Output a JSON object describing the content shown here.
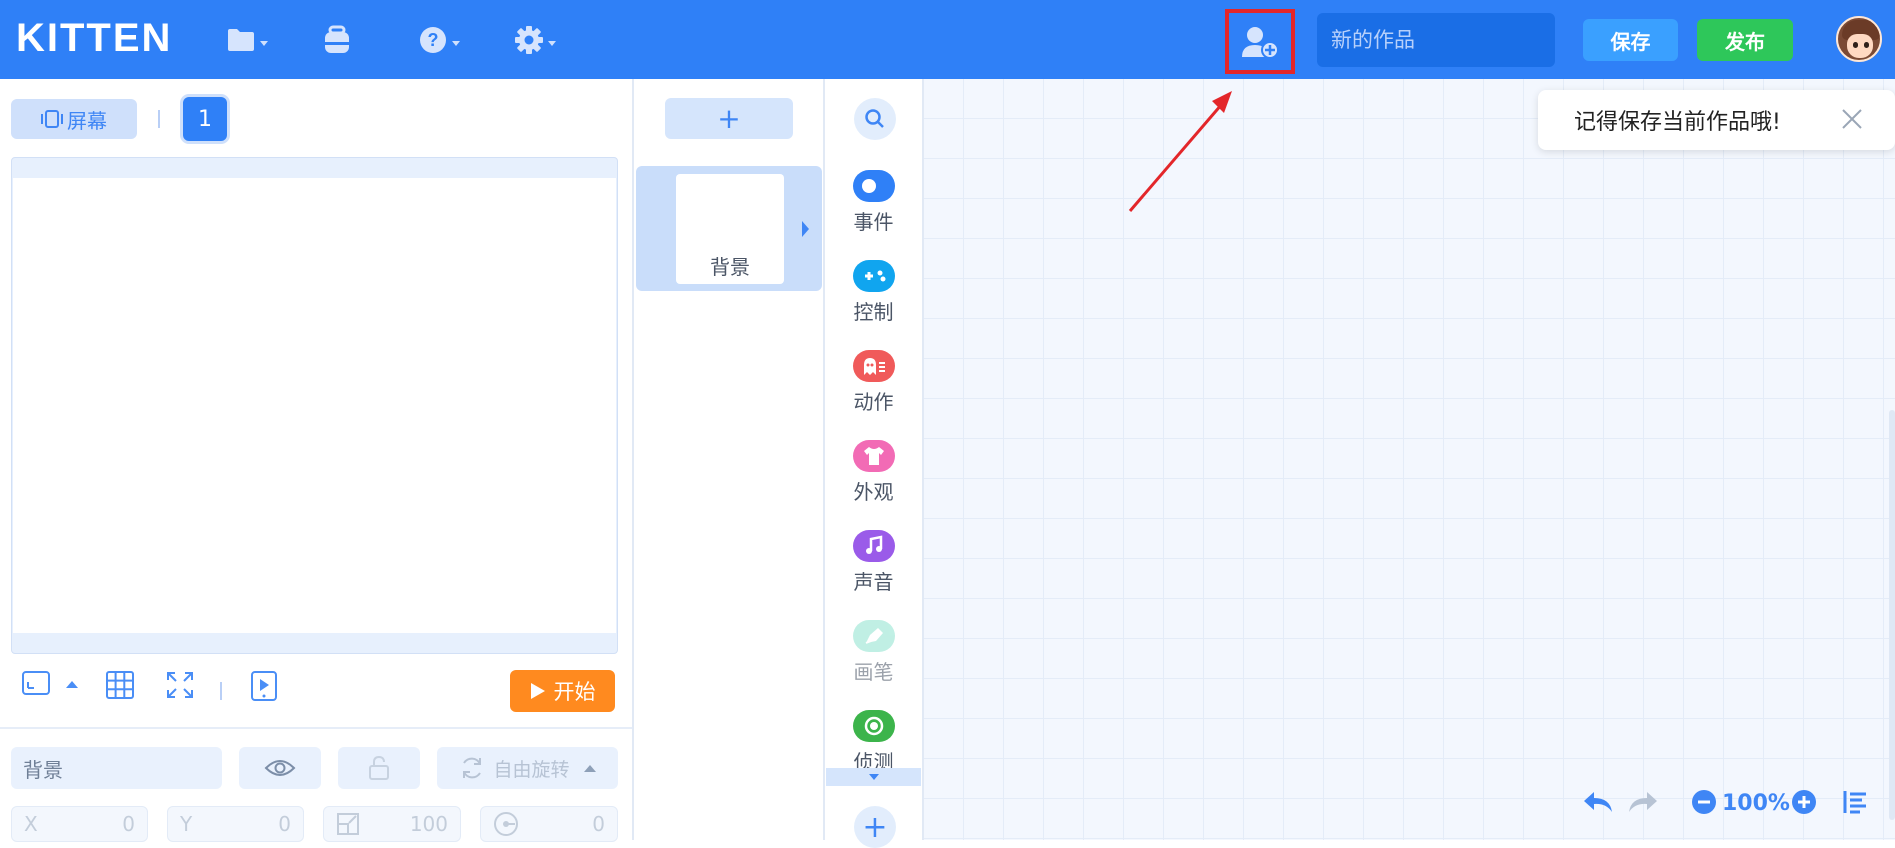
{
  "topbar": {
    "logo": "KITTEN",
    "title_placeholder": "新的作品",
    "save_label": "保存",
    "publish_label": "发布"
  },
  "stage": {
    "screen_tab_label": "屏幕",
    "page_number": "1",
    "start_label": "开始"
  },
  "properties": {
    "name_value": "背景",
    "rotation_label": "自由旋转",
    "x_label": "X",
    "x_value": "0",
    "y_label": "Y",
    "y_value": "0",
    "size_value": "100",
    "direction_value": "0"
  },
  "sprites": {
    "add_label": "+",
    "items": [
      {
        "label": "背景"
      }
    ]
  },
  "categories": [
    {
      "label": "事件",
      "icon": "toggle-icon",
      "color": "#2f80f7"
    },
    {
      "label": "控制",
      "icon": "gamepad-icon",
      "color": "#10a5ef"
    },
    {
      "label": "动作",
      "icon": "ghost-icon",
      "color": "#f05a5a"
    },
    {
      "label": "外观",
      "icon": "shirt-icon",
      "color": "#f26bb5"
    },
    {
      "label": "声音",
      "icon": "music-icon",
      "color": "#9a5be9"
    },
    {
      "label": "画笔",
      "icon": "pen-icon",
      "color": "#8ee3cf"
    },
    {
      "label": "侦测",
      "icon": "target-icon",
      "color": "#3cb44b"
    }
  ],
  "toast": {
    "message": "记得保存当前作品哦!"
  },
  "workspace": {
    "zoom": "100%"
  },
  "colors": {
    "topbar": "#2f80f7",
    "save": "#3aa0ff",
    "publish": "#2ec75a",
    "start": "#ff8a1f",
    "highlight": "#e3262a"
  }
}
